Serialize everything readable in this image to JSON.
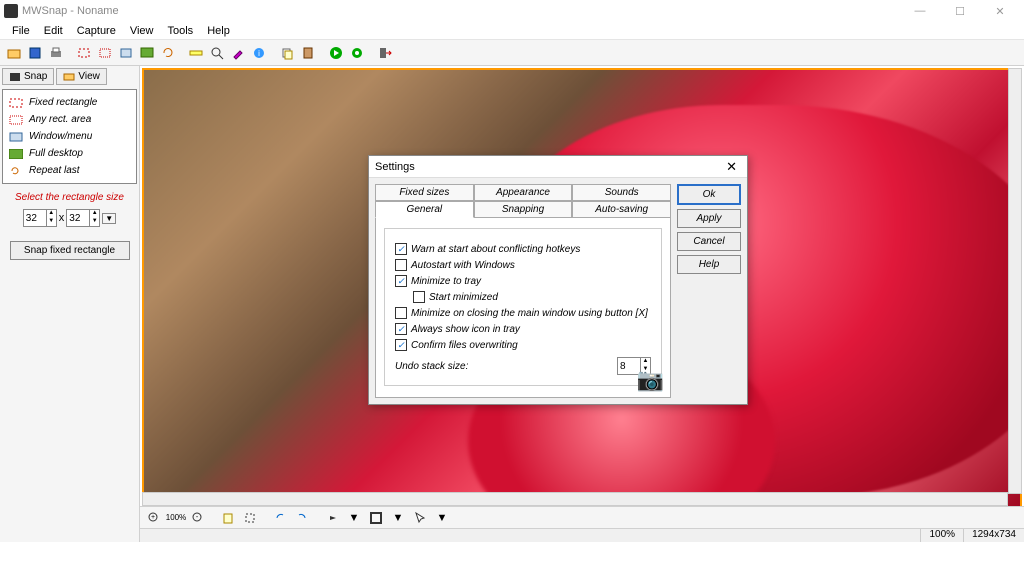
{
  "titlebar": {
    "title": "MWSnap - Noname"
  },
  "menubar": [
    "File",
    "Edit",
    "Capture",
    "View",
    "Tools",
    "Help"
  ],
  "sidebar": {
    "tabs": [
      {
        "label": "Snap"
      },
      {
        "label": "View"
      }
    ],
    "capture_items": [
      {
        "label": "Fixed rectangle"
      },
      {
        "label": "Any rect. area"
      },
      {
        "label": "Window/menu"
      },
      {
        "label": "Full desktop"
      },
      {
        "label": "Repeat last"
      }
    ],
    "select_size_label": "Select the rectangle size",
    "width": "32",
    "by": "x",
    "height": "32",
    "snap_btn": "Snap fixed rectangle"
  },
  "status": {
    "zoom": "100%",
    "dims": "1294x734"
  },
  "dialog": {
    "title": "Settings",
    "tabs_top": [
      "Fixed sizes",
      "Appearance",
      "Sounds"
    ],
    "tabs_bottom": [
      "General",
      "Snapping",
      "Auto-saving"
    ],
    "checks": [
      {
        "label": "Warn at start about conflicting hotkeys",
        "checked": true
      },
      {
        "label": "Autostart with Windows",
        "checked": false
      },
      {
        "label": "Minimize to tray",
        "checked": true
      },
      {
        "label": "Start minimized",
        "checked": false,
        "indent": true
      },
      {
        "label": "Minimize on closing the main window using button [X]",
        "checked": false
      },
      {
        "label": "Always show icon in tray",
        "checked": true
      },
      {
        "label": "Confirm files overwriting",
        "checked": true
      }
    ],
    "undo_label": "Undo stack size:",
    "undo_value": "8",
    "buttons": {
      "ok": "Ok",
      "apply": "Apply",
      "cancel": "Cancel",
      "help": "Help"
    }
  }
}
